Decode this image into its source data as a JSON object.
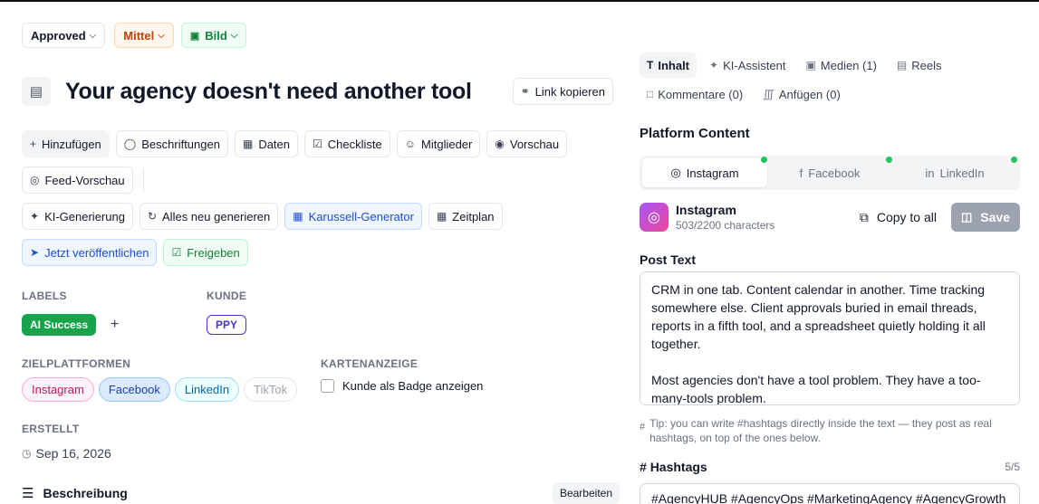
{
  "status": {
    "approved": "Approved",
    "priority": "Mittel",
    "type": "Bild"
  },
  "title": "Your agency doesn't need another tool",
  "copy_link": "Link kopieren",
  "toolbar1": [
    "Hinzufügen",
    "Beschriftungen",
    "Daten",
    "Checkliste",
    "Mitglieder",
    "Vorschau"
  ],
  "feed_preview": "Feed-Vorschau",
  "toolbar2": {
    "ai_generate": "KI-Generierung",
    "regenerate_all": "Alles neu generieren",
    "carousel": "Karussell-Generator",
    "schedule": "Zeitplan"
  },
  "publish_now": "Jetzt veröffentlichen",
  "share": "Freigeben",
  "labels": {
    "heading": "LABELS",
    "tag": "AI Success",
    "add": "+"
  },
  "client": {
    "heading": "KUNDE",
    "tag": "PPY"
  },
  "platforms": {
    "heading": "ZIELPLATTFORMEN",
    "items": [
      "Instagram",
      "Facebook",
      "LinkedIn",
      "TikTok"
    ]
  },
  "card_display": {
    "heading": "KARTENANZEIGE",
    "checkbox_label": "Kunde als Badge anzeigen"
  },
  "created": {
    "heading": "ERSTELLT",
    "date": "Sep 16, 2026"
  },
  "description": {
    "title": "Beschreibung",
    "edit": "Bearbeiten"
  },
  "right_tabs": [
    "Inhalt",
    "KI-Assistent",
    "Medien (1)",
    "Reels",
    "Kommentare (0)",
    "Anfügen (0)"
  ],
  "platform_content": {
    "title": "Platform Content",
    "tabs": [
      "Instagram",
      "Facebook",
      "LinkedIn"
    ],
    "active": {
      "name": "Instagram",
      "chars": "503/2200 characters",
      "copy_all": "Copy to all",
      "save": "Save"
    },
    "post_text_label": "Post Text",
    "post_text": "CRM in one tab. Content calendar in another. Time tracking somewhere else. Client approvals buried in email threads, reports in a fifth tool, and a spreadsheet quietly holding it all together.\n\nMost agencies don't have a tool problem. They have a too-many-tools problem.",
    "tip": "Tip: you can write #hashtags directly inside the text — they post as real hashtags, on top of the ones below.",
    "hashtags_label": "Hashtags",
    "hashtags_count": "5/5",
    "hashtags_preview": "#AgencyHUB #AgencyOps #MarketingAgency #AgencyGrowth"
  },
  "colors": {
    "accent_green": "#16a34a",
    "client_indigo": "#4338ca",
    "save_disabled": "#9ca3af"
  }
}
